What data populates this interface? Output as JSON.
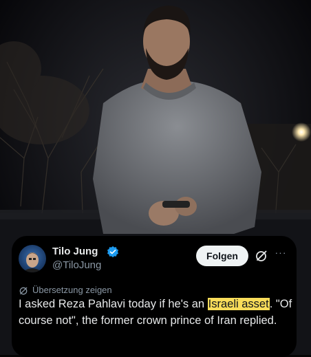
{
  "tweet": {
    "author_name": "Tilo Jung",
    "author_handle": "@TiloJung",
    "follow_label": "Folgen",
    "more_label": "···",
    "translate_label": "Übersetzung zeigen",
    "text_before": "I asked Reza Pahlavi today if he's an ",
    "text_highlight": "Israeli asset",
    "text_after": ". \"Of course not\", the former crown prince of Iran replied.",
    "highlight_color": "#f9dd5a",
    "verified_color": "#1d9bf0"
  },
  "icons": {
    "verified": "verified-badge-icon",
    "grok": "grok-icon",
    "more": "more-icon",
    "translate": "translate-icon"
  }
}
